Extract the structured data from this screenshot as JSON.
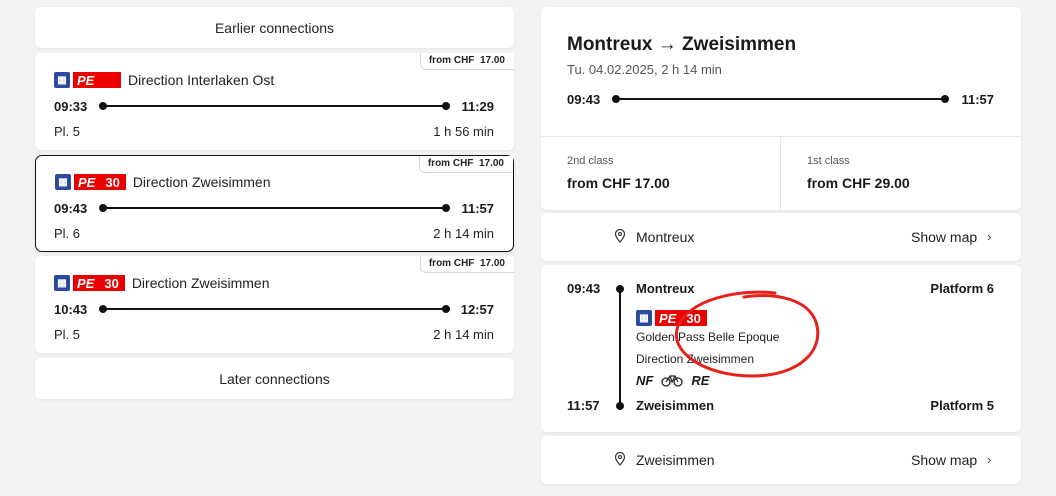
{
  "left": {
    "earlier_label": "Earlier connections",
    "later_label": "Later connections",
    "connections": [
      {
        "price_prefix": "from CHF",
        "price": "17.00",
        "line": "PE",
        "line_number": "",
        "direction": "Direction Interlaken Ost",
        "dep": "09:33",
        "arr": "11:29",
        "platform": "Pl. 5",
        "duration": "1 h 56 min",
        "selected": false
      },
      {
        "price_prefix": "from CHF",
        "price": "17.00",
        "line": "PE",
        "line_number": "30",
        "direction": "Direction Zweisimmen",
        "dep": "09:43",
        "arr": "11:57",
        "platform": "Pl. 6",
        "duration": "2 h 14 min",
        "selected": true
      },
      {
        "price_prefix": "from CHF",
        "price": "17.00",
        "line": "PE",
        "line_number": "30",
        "direction": "Direction Zweisimmen",
        "dep": "10:43",
        "arr": "12:57",
        "platform": "Pl. 5",
        "duration": "2 h 14 min",
        "selected": false
      }
    ]
  },
  "right": {
    "title": "Montreux → Zweisimmen",
    "subtitle": "Tu. 04.02.2025, 2 h 14 min",
    "dep": "09:43",
    "arr": "11:57",
    "classes": [
      {
        "label": "2nd class",
        "price": "from CHF 17.00"
      },
      {
        "label": "1st class",
        "price": "from CHF 29.00"
      }
    ],
    "origin_stop": "Montreux",
    "destination_stop": "Zweisimmen",
    "show_map": "Show map",
    "journey": {
      "dep_time": "09:43",
      "dep_station": "Montreux",
      "dep_platform": "Platform 6",
      "line": "PE",
      "line_number": "30",
      "train_name": "Golden Pass Belle Epoque",
      "direction": "Direction Zweisimmen",
      "attributes": [
        "NF",
        "RE"
      ],
      "arr_time": "11:57",
      "arr_station": "Zweisimmen",
      "arr_platform": "Platform 5"
    }
  },
  "colors": {
    "brand_red": "#eb0000",
    "train_icon_blue": "#2b4a9e",
    "annotation_red": "#e8201c"
  },
  "icons": [
    "train-icon",
    "location-pin-icon",
    "chevron-right-icon",
    "bicycle-icon"
  ]
}
